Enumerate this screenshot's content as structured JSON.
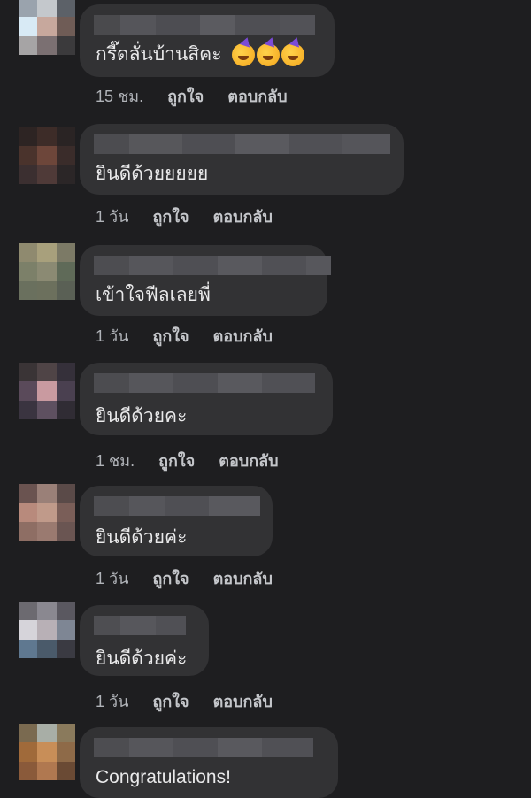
{
  "comments": [
    {
      "text": "กรี๊ดลั่นบ้านสิคะ",
      "time": "15 ชม.",
      "like": "ถูกใจ",
      "reply": "ตอบกลับ"
    },
    {
      "text": "ยินดีด้วยยยยย",
      "time": "1 วัน",
      "like": "ถูกใจ",
      "reply": "ตอบกลับ"
    },
    {
      "text": "เข้าใจฟีลเลยพี่",
      "time": "1 วัน",
      "like": "ถูกใจ",
      "reply": "ตอบกลับ"
    },
    {
      "text": "ยินดีด้วยคะ",
      "time": "1 ชม.",
      "like": "ถูกใจ",
      "reply": "ตอบกลับ"
    },
    {
      "text": "ยินดีด้วยค่ะ",
      "time": "1 วัน",
      "like": "ถูกใจ",
      "reply": "ตอบกลับ"
    },
    {
      "text": "ยินดีด้วยค่ะ",
      "time": "1 วัน",
      "like": "ถูกใจ",
      "reply": "ตอบกลับ"
    },
    {
      "text": "Congratulations!"
    }
  ],
  "emoji": [
    "partying-face-icon",
    "partying-face-icon",
    "partying-face-icon"
  ],
  "colors": {
    "background": "#1e1e20",
    "bubble": "#323234",
    "meta_text": "#b0b3b8"
  }
}
